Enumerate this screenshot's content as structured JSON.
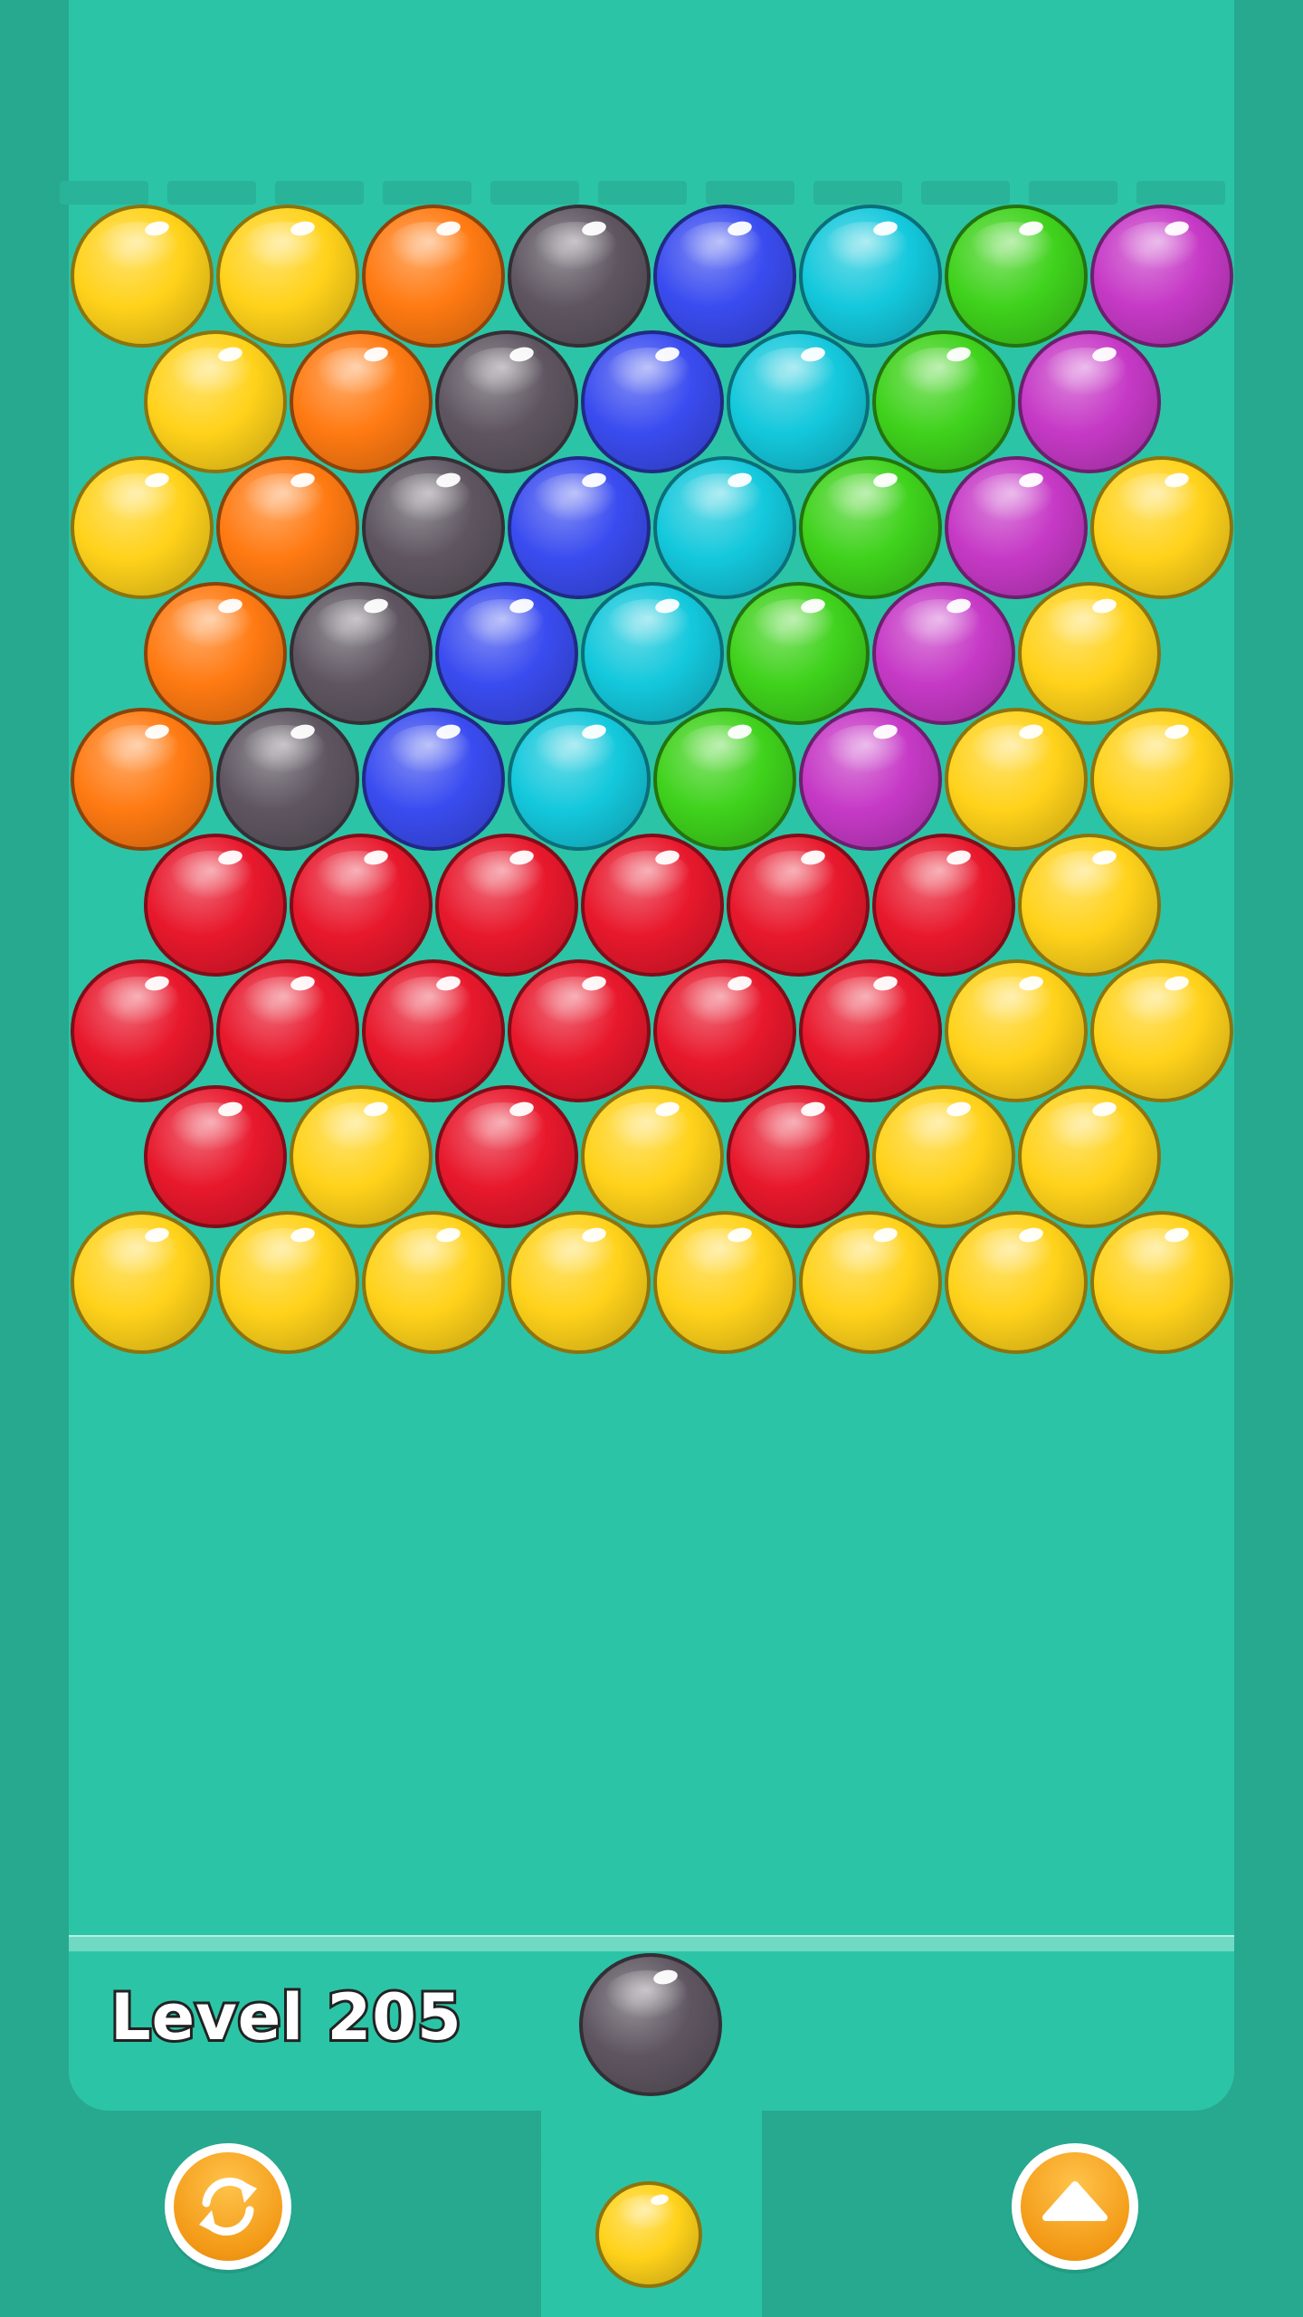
{
  "game": {
    "level_text": "Level 205"
  },
  "colors": {
    "yellow": "#ffd21a",
    "orange": "#ff7a12",
    "gray": "#5e5560",
    "blue": "#3a4cf0",
    "cyan": "#14c8dc",
    "green": "#3fd21c",
    "magenta": "#c639c6",
    "red": "#e8182c"
  },
  "board": {
    "rows": [
      [
        "yellow",
        "yellow",
        "orange",
        "gray",
        "blue",
        "cyan",
        "green",
        "magenta"
      ],
      [
        "yellow",
        "orange",
        "gray",
        "blue",
        "cyan",
        "green",
        "magenta"
      ],
      [
        "yellow",
        "orange",
        "gray",
        "blue",
        "cyan",
        "green",
        "magenta",
        "yellow"
      ],
      [
        "orange",
        "gray",
        "blue",
        "cyan",
        "green",
        "magenta",
        "yellow"
      ],
      [
        "orange",
        "gray",
        "blue",
        "cyan",
        "green",
        "magenta",
        "yellow",
        "yellow"
      ],
      [
        "red",
        "red",
        "red",
        "red",
        "red",
        "red",
        "yellow"
      ],
      [
        "red",
        "red",
        "red",
        "red",
        "red",
        "red",
        "yellow",
        "yellow"
      ],
      [
        "red",
        "yellow",
        "red",
        "yellow",
        "red",
        "yellow",
        "yellow"
      ],
      [
        "yellow",
        "yellow",
        "yellow",
        "yellow",
        "yellow",
        "yellow",
        "yellow",
        "yellow"
      ]
    ]
  },
  "shooter": {
    "current_color": "gray",
    "next_color": "yellow"
  },
  "controls": {
    "swap_icon": "swap-arrows-icon",
    "aim_icon": "chevron-up-icon"
  }
}
